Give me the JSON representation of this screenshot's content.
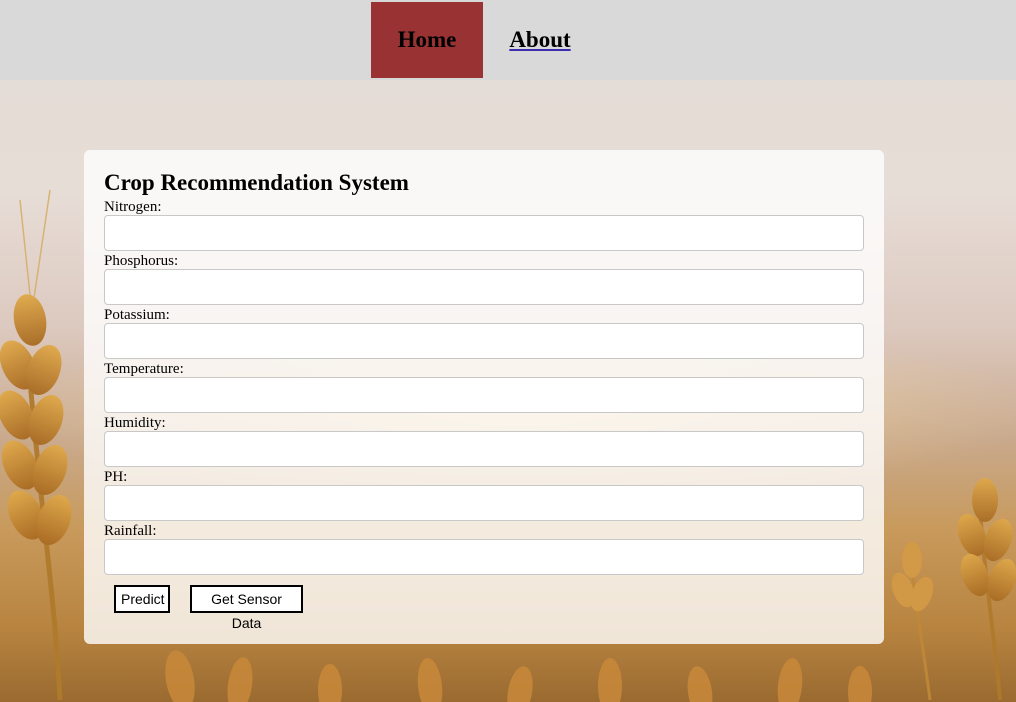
{
  "nav": {
    "home_label": "Home",
    "about_label": "About",
    "active_color": "#993333"
  },
  "form": {
    "title": "Crop Recommendation System",
    "fields": [
      {
        "label": "Nitrogen:",
        "value": ""
      },
      {
        "label": "Phosphorus:",
        "value": ""
      },
      {
        "label": "Potassium:",
        "value": ""
      },
      {
        "label": "Temperature:",
        "value": ""
      },
      {
        "label": "Humidity:",
        "value": ""
      },
      {
        "label": "PH:",
        "value": ""
      },
      {
        "label": "Rainfall:",
        "value": ""
      }
    ],
    "predict_label": "Predict",
    "sensor_label": "Get Sensor Data"
  }
}
